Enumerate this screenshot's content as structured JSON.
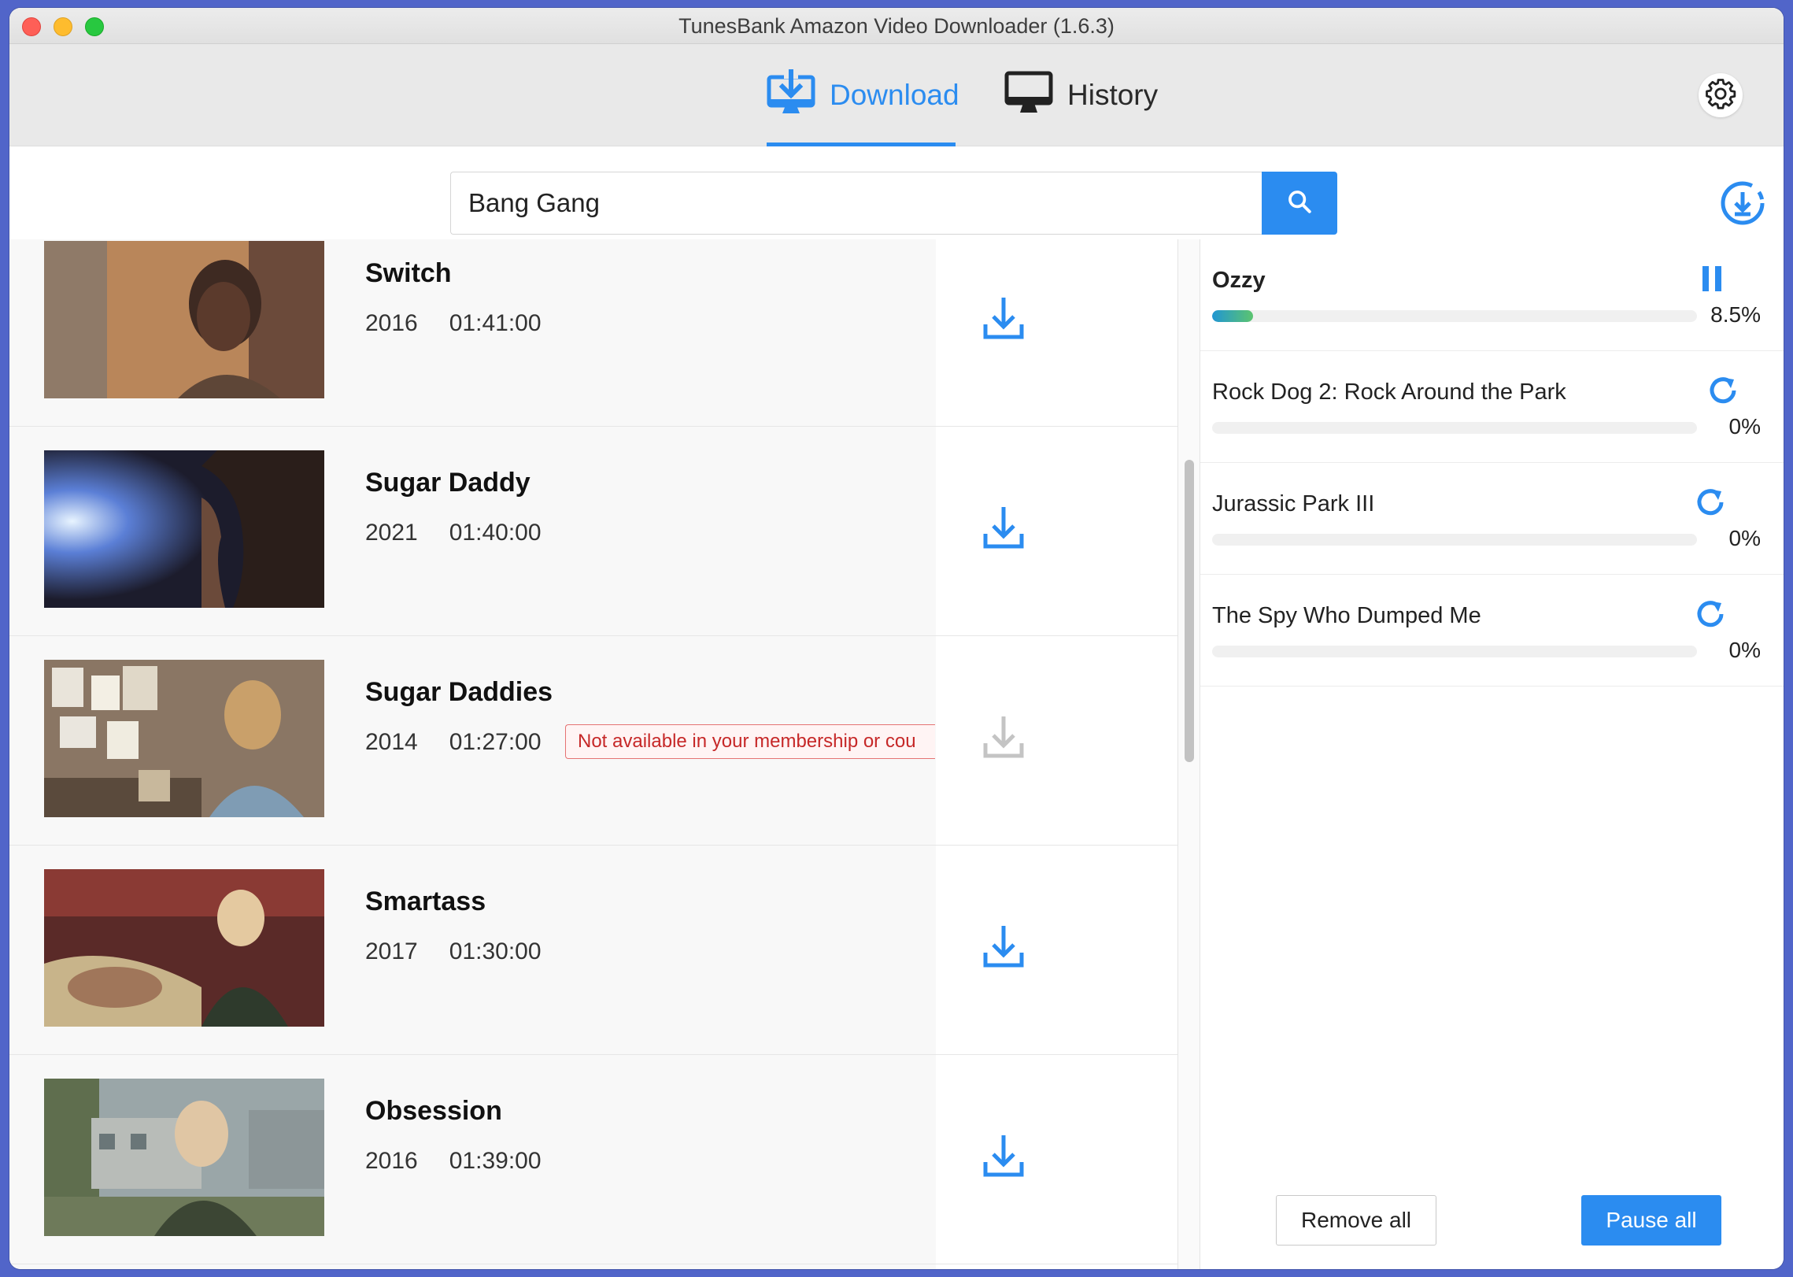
{
  "window": {
    "title": "TunesBank Amazon Video Downloader (1.6.3)"
  },
  "tabs": [
    {
      "label": "Download",
      "icon": "download-monitor-icon",
      "active": true
    },
    {
      "label": "History",
      "icon": "monitor-icon",
      "active": false
    }
  ],
  "search": {
    "value": "Bang Gang",
    "placeholder": ""
  },
  "colors": {
    "accent": "#2b8cf0",
    "error": "#c62828"
  },
  "results": [
    {
      "title": "Switch",
      "year": "2016",
      "duration": "01:41:00",
      "available": true,
      "notice": ""
    },
    {
      "title": "Sugar Daddy",
      "year": "2021",
      "duration": "01:40:00",
      "available": true,
      "notice": ""
    },
    {
      "title": "Sugar Daddies",
      "year": "2014",
      "duration": "01:27:00",
      "available": false,
      "notice": "Not available in your membership or cou"
    },
    {
      "title": "Smartass",
      "year": "2017",
      "duration": "01:30:00",
      "available": true,
      "notice": ""
    },
    {
      "title": "Obsession",
      "year": "2016",
      "duration": "01:39:00",
      "available": true,
      "notice": ""
    }
  ],
  "queue": [
    {
      "title": "Ozzy",
      "percent": "8.5%",
      "progress": 0.085,
      "state": "downloading",
      "icon": "pause-icon"
    },
    {
      "title": "Rock Dog 2: Rock Around the Park",
      "percent": "0%",
      "progress": 0,
      "state": "waiting",
      "icon": "refresh-icon"
    },
    {
      "title": "Jurassic Park III",
      "percent": "0%",
      "progress": 0,
      "state": "waiting",
      "icon": "refresh-icon"
    },
    {
      "title": "The Spy Who Dumped Me",
      "percent": "0%",
      "progress": 0,
      "state": "waiting",
      "icon": "refresh-icon"
    }
  ],
  "actions": {
    "remove_all": "Remove all",
    "pause_all": "Pause all"
  }
}
